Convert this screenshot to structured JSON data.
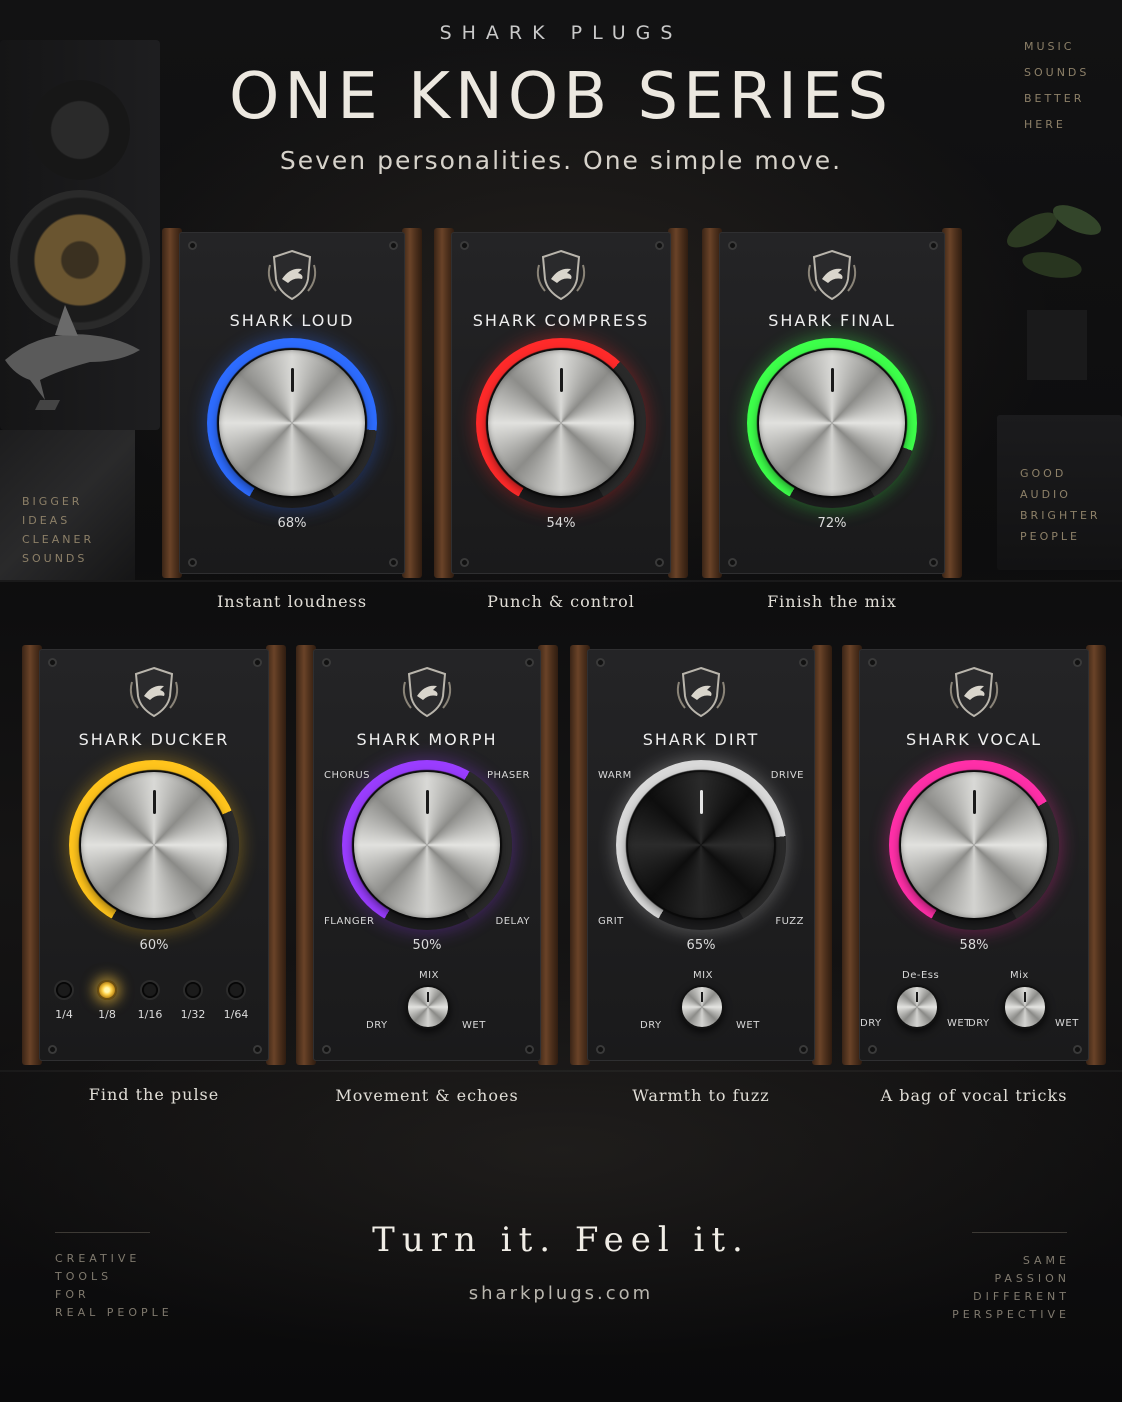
{
  "brand": "SHARK PLUGS",
  "title": "ONE KNOB SERIES",
  "subtitle": "Seven personalities. One simple move.",
  "side_notes": {
    "top_right": [
      "MUSIC",
      "SOUNDS",
      "BETTER",
      "HERE"
    ],
    "left": [
      "BIGGER",
      "IDEAS",
      "CLEANER",
      "SOUNDS"
    ],
    "right": [
      "GOOD",
      "AUDIO",
      "BRIGHTER",
      "PEOPLE"
    ],
    "bottom_left": [
      "CREATIVE",
      "TOOLS",
      "FOR",
      "REAL PEOPLE"
    ],
    "bottom_right": [
      "SAME",
      "PASSION",
      "DIFFERENT",
      "PERSPECTIVE"
    ]
  },
  "plugins": [
    {
      "name": "SHARK LOUD",
      "value": "68%",
      "level": 0.68,
      "color": "#2d6cff",
      "caption": "Instant loudness"
    },
    {
      "name": "SHARK COMPRESS",
      "value": "54%",
      "level": 0.54,
      "color": "#ff2a2a",
      "caption": "Punch & control"
    },
    {
      "name": "SHARK FINAL",
      "value": "72%",
      "level": 0.72,
      "color": "#3dff4a",
      "caption": "Finish the mix"
    },
    {
      "name": "SHARK DUCKER",
      "value": "60%",
      "level": 0.6,
      "color": "#ffc41c",
      "caption": "Find the pulse",
      "rates": [
        "1/4",
        "1/8",
        "1/16",
        "1/32",
        "1/64"
      ],
      "active_rate": "1/8"
    },
    {
      "name": "SHARK MORPH",
      "value": "50%",
      "level": 0.5,
      "color": "#9a3dff",
      "caption": "Movement & echoes",
      "corner_labels": [
        "CHORUS",
        "PHASER",
        "FLANGER",
        "DELAY"
      ],
      "mix_label": "MIX",
      "dry_label": "DRY",
      "wet_label": "WET"
    },
    {
      "name": "SHARK DIRT",
      "value": "65%",
      "level": 0.65,
      "color": "#d9d9d9",
      "caption": "Warmth to fuzz",
      "corner_labels": [
        "WARM",
        "DRIVE",
        "GRIT",
        "FUZZ"
      ],
      "mix_label": "MIX",
      "dry_label": "DRY",
      "wet_label": "WET"
    },
    {
      "name": "SHARK VOCAL",
      "value": "58%",
      "level": 0.58,
      "color": "#ff2fa8",
      "caption": "A bag of vocal tricks",
      "mini_knobs": [
        {
          "label": "De-Ess",
          "dry": "DRY",
          "wet": "WET"
        },
        {
          "label": "Mix",
          "dry": "DRY",
          "wet": "WET"
        }
      ]
    }
  ],
  "tagline": "Turn it. Feel it.",
  "url": "sharkplugs.com",
  "icons": {
    "crest": "shark-shield-crest-icon"
  }
}
